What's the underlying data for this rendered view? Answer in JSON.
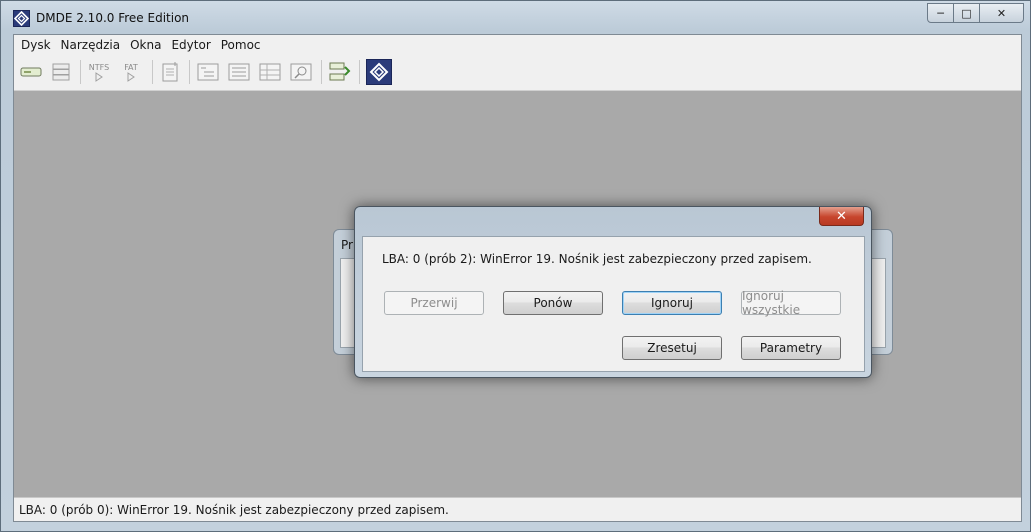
{
  "window": {
    "title": "DMDE 2.10.0 Free Edition",
    "caption_buttons": {
      "minimize": "─",
      "maximize": "□",
      "close": "✕"
    }
  },
  "menu": [
    "Dysk",
    "Narzędzia",
    "Okna",
    "Edytor",
    "Pomoc"
  ],
  "toolbar": {
    "ntfs_label": "NTFS",
    "fat_label": "FAT",
    "icons": [
      "disk-icon",
      "partitions-icon",
      "ntfs-icon",
      "fat-icon",
      "new-file-icon",
      "tree-icon",
      "list-icon",
      "table-icon",
      "search-icon",
      "go-icon",
      "logo-icon"
    ]
  },
  "background_dialog": {
    "title": "Pr"
  },
  "error_dialog": {
    "close_label": "✕",
    "message": "LBA: 0 (prób 2): WinError 19. Nośnik jest zabezpieczony przed zapisem.",
    "buttons": {
      "abort": "Przerwij",
      "retry": "Ponów",
      "ignore": "Ignoruj",
      "ignore_all": "Ignoruj wszystkie",
      "reset": "Zresetuj",
      "params": "Parametry"
    }
  },
  "status": "LBA: 0 (prób 0): WinError 19. Nośnik jest zabezpieczony przed zapisem."
}
